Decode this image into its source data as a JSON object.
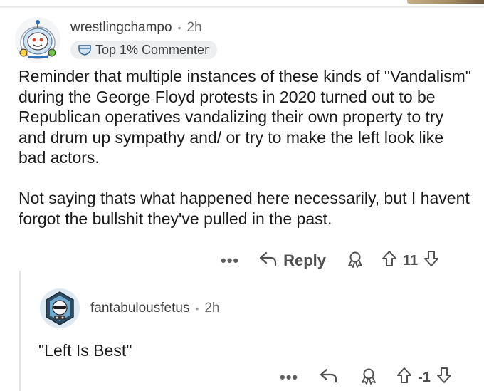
{
  "comment": {
    "username": "wrestlingchampo",
    "separator": "•",
    "time": "2h",
    "badge": "Top 1% Commenter",
    "paragraphs": [
      "Reminder that multiple instances of these kinds of \"Vandalism\" during the George Floyd protests in 2020 turned out to be Republican operatives vandalizing their own property to try and drum up sympathy and/ or try to make the left look like bad actors.",
      "Not saying thats what happened here necessarily, but I havent forgot the bullshit they've pulled in the past."
    ],
    "more": "•••",
    "reply_label": "Reply",
    "score": "11"
  },
  "reply": {
    "username": "fantabulousfetus",
    "separator": "•",
    "time": "2h",
    "text": "\"Left Is Best\"",
    "more": "•••",
    "score": "-1"
  },
  "icons": {
    "more": "more-horizontal-icon",
    "reply": "reply-arrow-icon",
    "award": "award-icon",
    "upvote": "upvote-arrow-icon",
    "downvote": "downvote-arrow-icon",
    "badge": "badge-shield-icon"
  },
  "colors": {
    "text": "#1a1a1b",
    "muted": "#6b6b6b",
    "badge_bg": "#eceef0",
    "action": "#505050"
  }
}
